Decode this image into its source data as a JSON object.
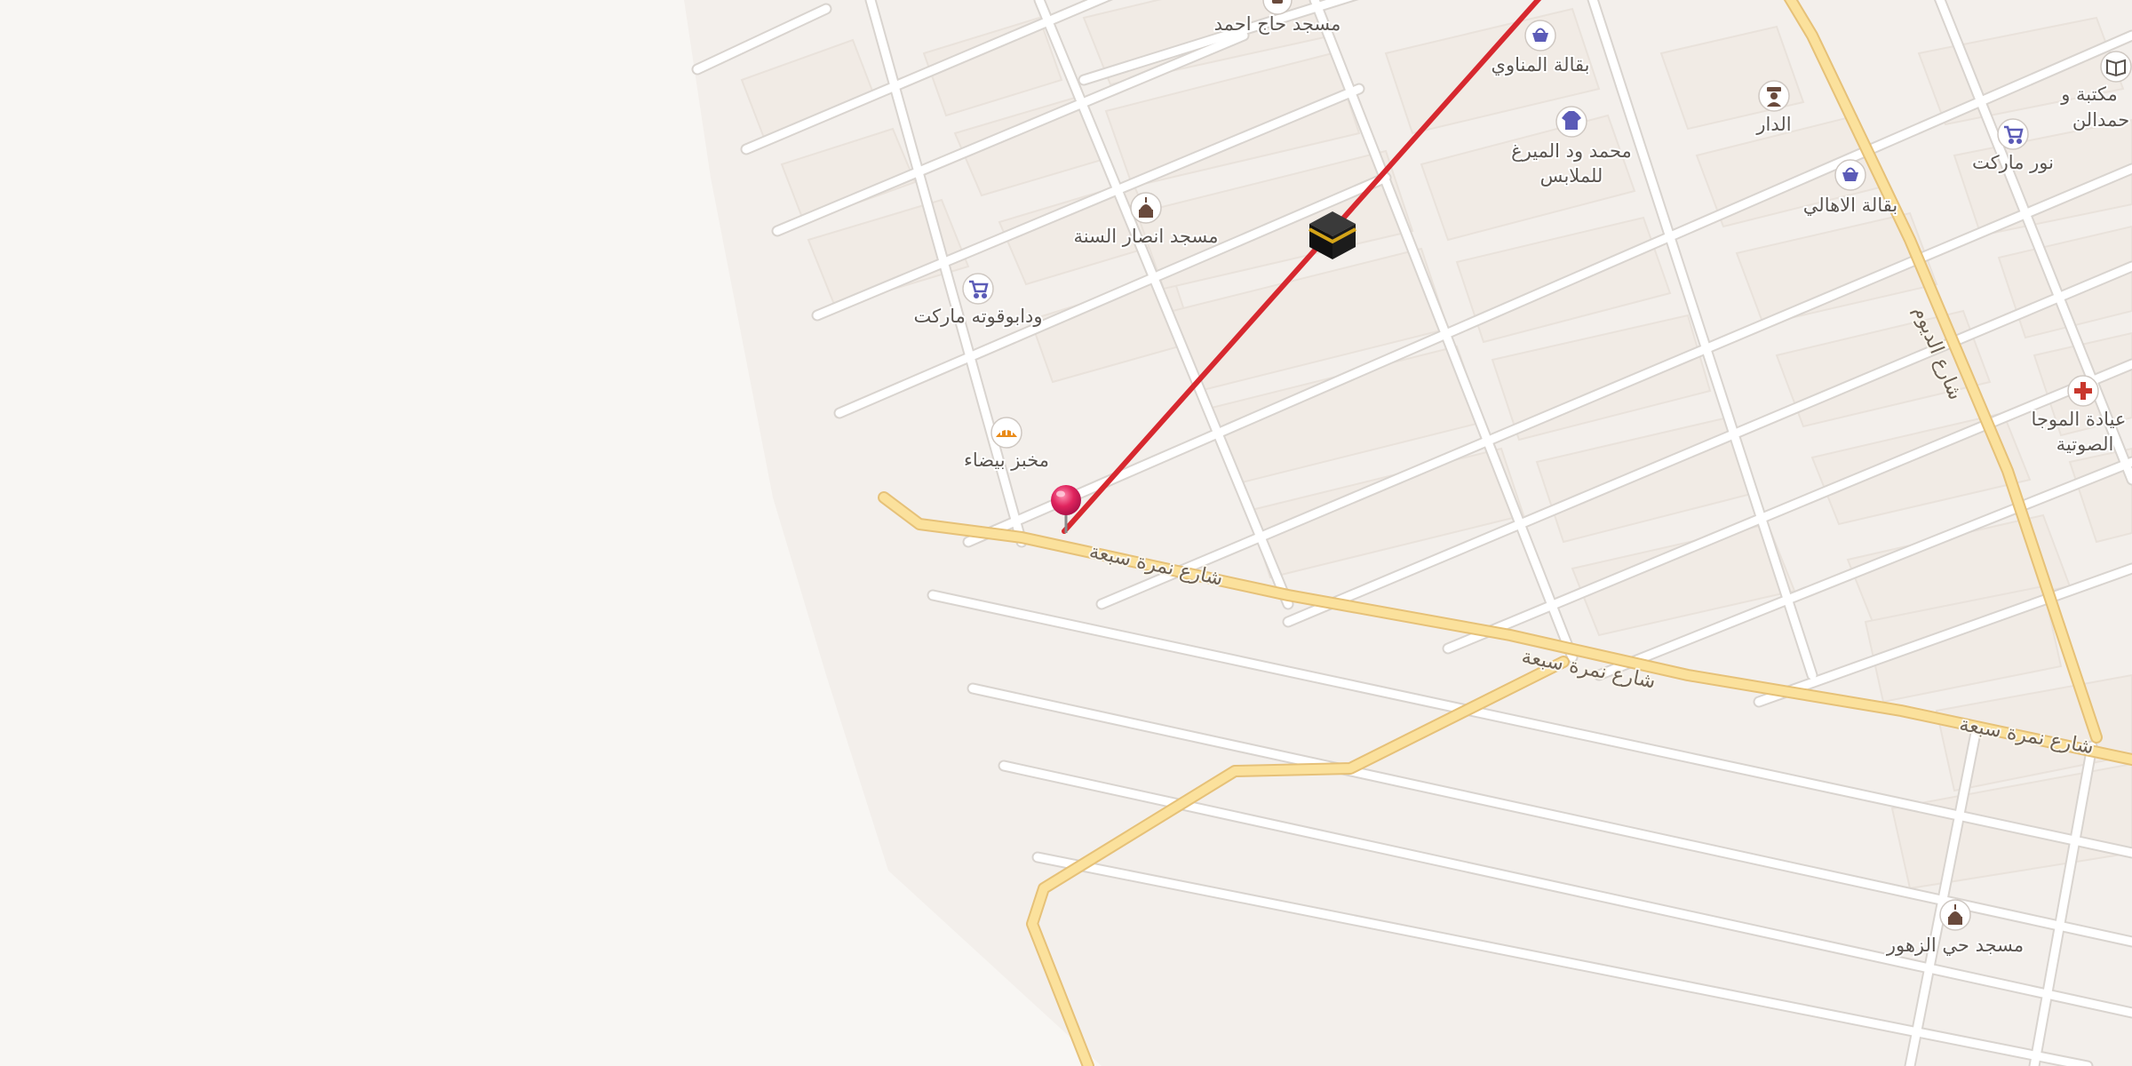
{
  "map": {
    "colors": {
      "background": "#f8f6f3",
      "built_area": "#f1ece7",
      "block": "#f4efea",
      "minor_road": "#ffffff",
      "major_road": "#fbe19c",
      "major_road_casing": "#e6c178",
      "route_line": "#d7282f",
      "pin": "#e0245e",
      "poi_blue": "#5b5bb7",
      "poi_brown": "#6a4a3c",
      "poi_orange": "#e98b1a",
      "poi_red": "#c8372d"
    },
    "roads": [
      {
        "id": "upper",
        "name": "شارع نمرة سبعة"
      },
      {
        "id": "middle",
        "name": "شارع نمرة سبعة"
      },
      {
        "id": "right",
        "name": "شارع نمرة سبعة"
      },
      {
        "id": "vertical",
        "name": "شارع الديوم"
      }
    ],
    "pois": [
      {
        "id": "masjid-haj-ahmed",
        "icon": "mosque-icon",
        "label": "مسجد حاج احمد"
      },
      {
        "id": "baqala-almanawi",
        "icon": "shopping-basket-icon",
        "label": "بقالة المناوي"
      },
      {
        "id": "dar",
        "icon": "police-icon",
        "label": "الدار"
      },
      {
        "id": "maktaba",
        "icon": "book-icon",
        "lines": [
          "مكتبة و",
          "حمدالن"
        ]
      },
      {
        "id": "mohamed-wad-almirghani",
        "icon": "shirt-icon",
        "lines": [
          "محمد ود الميرغ",
          "للملابس"
        ]
      },
      {
        "id": "noor-market",
        "icon": "shopping-cart-icon",
        "label": "نور ماركت"
      },
      {
        "id": "baqala-alahali",
        "icon": "shopping-basket-icon",
        "label": "بقالة الاهالي"
      },
      {
        "id": "masjid-ansar",
        "icon": "mosque-icon",
        "label": "مسجد انصار السنة"
      },
      {
        "id": "wad-abu-qouta-market",
        "icon": "shopping-cart-icon",
        "label": "ودابوقوته ماركت"
      },
      {
        "id": "makhbaz-baida",
        "icon": "bakery-icon",
        "label": "مخبز بيضاء"
      },
      {
        "id": "clinic",
        "icon": "medical-cross-icon",
        "lines": [
          "عيادة الموجا",
          "الصوتية"
        ]
      },
      {
        "id": "masjid-hay-zuhur",
        "icon": "mosque-icon",
        "label": "مسجد حي الزهور"
      }
    ],
    "markers": {
      "kaaba": {
        "icon": "kaaba-icon"
      },
      "pin": {
        "icon": "location-pin-icon"
      }
    }
  }
}
